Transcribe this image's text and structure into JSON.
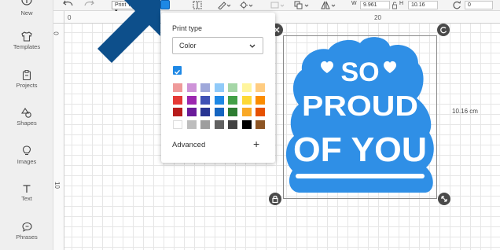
{
  "sidebar": {
    "items": [
      {
        "label": "New"
      },
      {
        "label": "Templates"
      },
      {
        "label": "Projects"
      },
      {
        "label": "Shapes"
      },
      {
        "label": "Images"
      },
      {
        "label": "Text"
      },
      {
        "label": "Phrases"
      }
    ]
  },
  "toolbar": {
    "operation_label": "Print Then Cut",
    "fill_color": "#1e88e5",
    "w_label": "W",
    "w_value": "9.961",
    "h_label": "H",
    "h_value": "10.16",
    "rotate_value": "0"
  },
  "rulers": {
    "top_ticks": [
      "0",
      "20"
    ],
    "left_ticks": [
      "0",
      "10"
    ]
  },
  "design": {
    "text_lines": [
      "SO",
      "PROUD",
      "OF YOU"
    ],
    "color": "#2f8fe6",
    "height_label": "10.16 cm"
  },
  "popup": {
    "title": "Print type",
    "selected": "Color",
    "advanced_label": "Advanced",
    "swatch_rows": [
      [
        "#ef9a9a",
        "#ce93d8",
        "#9fa8da",
        "#90caf9",
        "#a5d6a7",
        "#fff59d",
        "#ffcc80"
      ],
      [
        "#e53935",
        "#9c27b0",
        "#3f51b5",
        "#1e88e5",
        "#43a047",
        "#fdd835",
        "#fb8c00"
      ],
      [
        "#b71c1c",
        "#6a1b9a",
        "#283593",
        "#1565c0",
        "#2e7d32",
        "#f9a825",
        "#e65100"
      ],
      [
        "#ffffff",
        "#bdbdbd",
        "#9e9e9e",
        "#616161",
        "#424242",
        "#000000",
        "#8d5524"
      ]
    ]
  }
}
